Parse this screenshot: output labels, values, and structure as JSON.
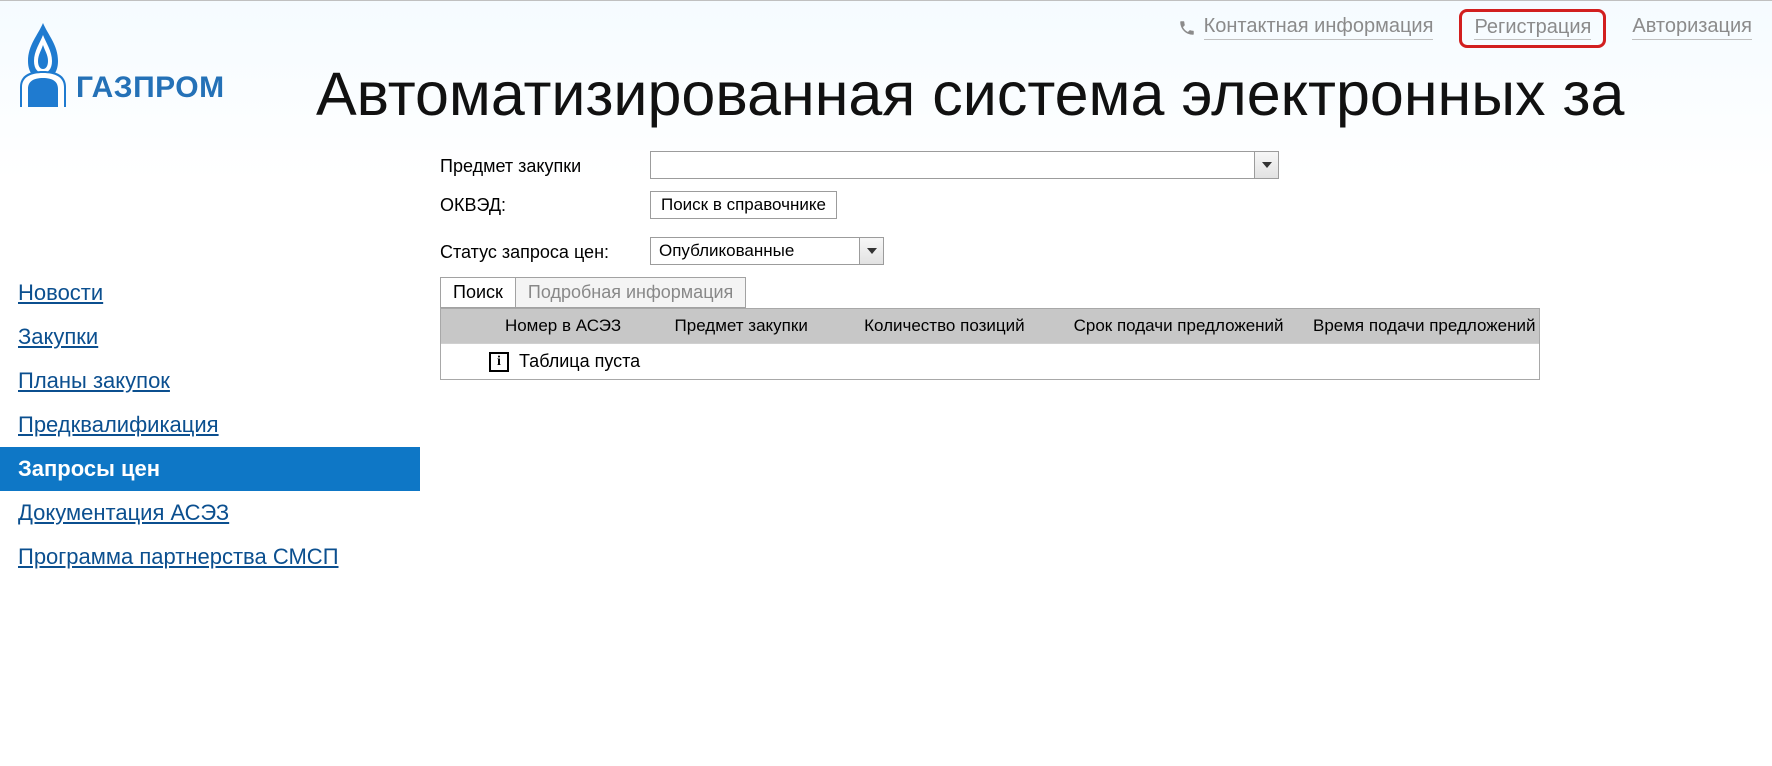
{
  "topLinks": {
    "contact": "Контактная информация",
    "register": "Регистрация",
    "login": "Авторизация"
  },
  "logo": {
    "brand": "ГАЗПРОМ"
  },
  "title": "Автоматизированная система электронных за",
  "nav": {
    "items": [
      {
        "label": "Новости",
        "active": false
      },
      {
        "label": "Закупки",
        "active": false
      },
      {
        "label": "Планы закупок",
        "active": false
      },
      {
        "label": "Предквалификация",
        "active": false
      },
      {
        "label": "Запросы цен",
        "active": true
      },
      {
        "label": "Документация АСЭЗ",
        "active": false
      },
      {
        "label": "Программа партнерства СМСП",
        "active": false
      }
    ]
  },
  "form": {
    "subjectLabel": "Предмет закупки",
    "okvedLabel": "ОКВЭД:",
    "okvedButton": "Поиск в справочнике",
    "statusLabel": "Статус запроса цен:",
    "statusValue": "Опубликованные"
  },
  "tabs": {
    "search": "Поиск",
    "details": "Подробная информация"
  },
  "table": {
    "headers": {
      "num": "Номер в АСЭЗ",
      "subject": "Предмет закупки",
      "count": "Количество позиций",
      "deadline": "Срок подачи предложений",
      "time": "Время подачи предложений"
    },
    "emptyText": "Таблица пуста"
  }
}
